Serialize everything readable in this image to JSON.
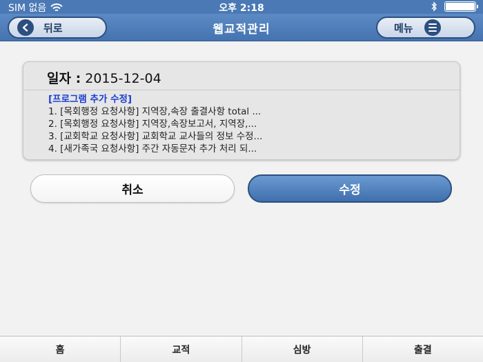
{
  "status_bar": {
    "carrier": "SIM 없음",
    "time": "오후 2:18"
  },
  "nav_bar": {
    "title": "웹교적관리",
    "back_label": "뒤로",
    "menu_label": "메뉴"
  },
  "card": {
    "date_label": "일자 :",
    "date_value": "2015-12-04",
    "heading": "[프로그램 추가 수정]",
    "items": [
      "1. [목회행정 요청사항] 지역장,속장 출결사항 total ...",
      "2. [목회행정 요청사항] 지역장,속장보고서, 지역장,...",
      "3. [교회학교 요청사항] 교회학교 교사들의 정보 수정...",
      "4. [새가족국 요청사항] 주간 자동문자 추가 처리 되..."
    ]
  },
  "actions": {
    "cancel_label": "취소",
    "save_label": "수정"
  },
  "tab_bar": {
    "tabs": [
      "홈",
      "교적",
      "심방",
      "출결"
    ]
  },
  "colors": {
    "nav_blue": "#4a79b5",
    "accent_dark": "#2c4f80",
    "heading_blue": "#1a3fd0"
  }
}
